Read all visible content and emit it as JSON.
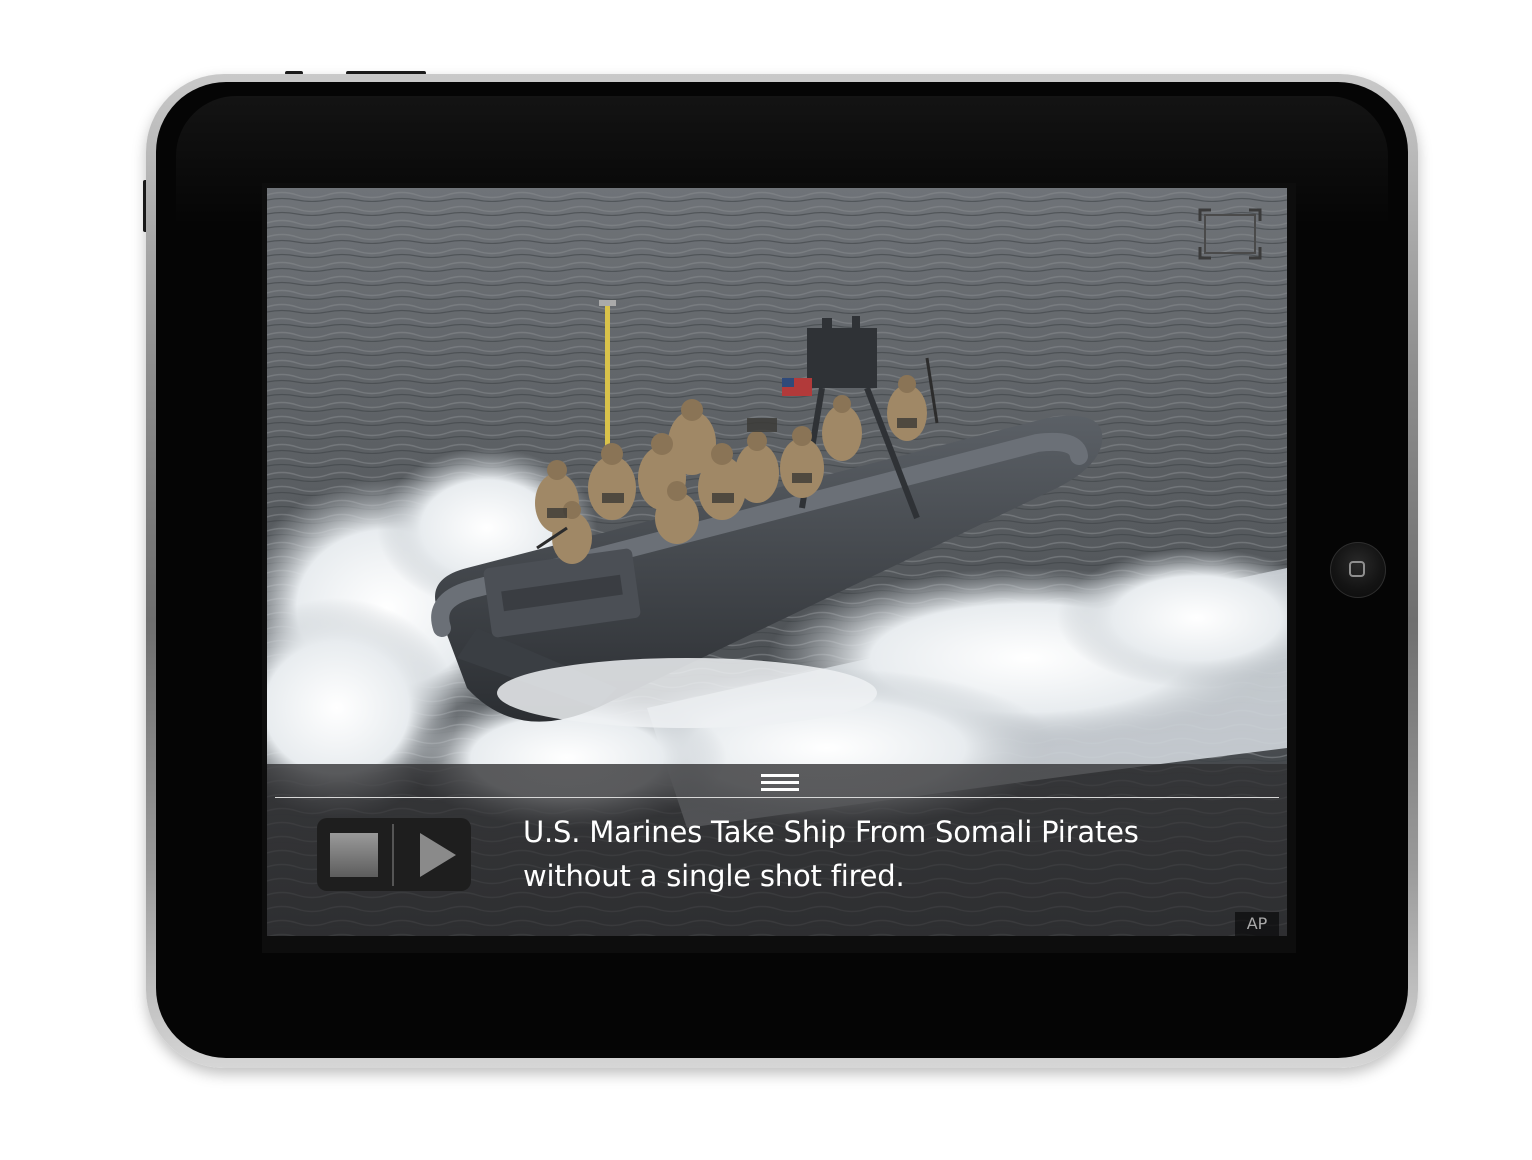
{
  "device": {
    "model": "tablet",
    "home_button_icon": "home-square-icon"
  },
  "viewer": {
    "fullscreen_icon": "fullscreen-corners-icon",
    "menu_icon": "hamburger-icon",
    "media_controls": {
      "stop_icon": "stop-square-icon",
      "play_icon": "play-triangle-icon"
    }
  },
  "article": {
    "headline_line1": "U.S. Marines Take Ship From Somali Pirates",
    "headline_line2": "without a single shot fired.",
    "photo_credit": "AP"
  },
  "colors": {
    "bezel": "#050505",
    "caption_overlay": "#303032",
    "headline_text": "#ffffff"
  }
}
